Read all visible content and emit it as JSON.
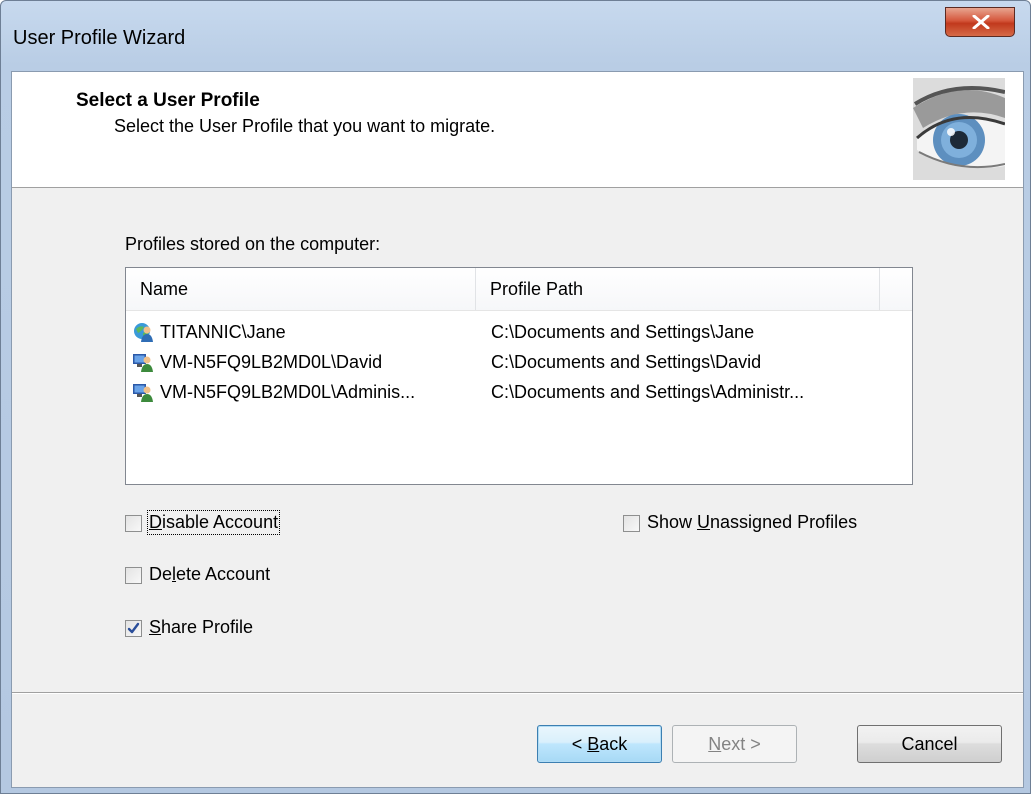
{
  "window": {
    "title": "User Profile Wizard"
  },
  "header": {
    "title": "Select a User Profile",
    "subtitle": "Select the User Profile that you want to migrate."
  },
  "profiles": {
    "label": "Profiles stored on the computer:",
    "columns": [
      "Name",
      "Profile Path"
    ],
    "rows": [
      {
        "name": "TITANNIC\\Jane",
        "path": "C:\\Documents and Settings\\Jane",
        "icon": "domain-user-icon"
      },
      {
        "name": "VM-N5FQ9LB2MD0L\\David",
        "path": "C:\\Documents and Settings\\David",
        "icon": "local-user-icon"
      },
      {
        "name": "VM-N5FQ9LB2MD0L\\Adminis...",
        "path": "C:\\Documents and Settings\\Administr...",
        "icon": "local-user-icon"
      }
    ]
  },
  "options": {
    "disable_account": {
      "pre": "",
      "key": "D",
      "post": "isable Account",
      "checked": false
    },
    "delete_account": {
      "pre": "De",
      "key": "l",
      "post": "ete Account",
      "checked": false
    },
    "share_profile": {
      "pre": "",
      "key": "S",
      "post": "hare Profile",
      "checked": true
    },
    "show_unassigned": {
      "pre": "Show ",
      "key": "U",
      "post": "nassigned Profiles",
      "checked": false
    }
  },
  "buttons": {
    "back": {
      "pre": "< ",
      "key": "B",
      "post": "ack"
    },
    "next": {
      "pre": "",
      "key": "N",
      "post": "ext >"
    },
    "cancel": "Cancel"
  },
  "colors": {
    "close_button": "#c1391d",
    "default_button_border": "#3c7fb1"
  }
}
